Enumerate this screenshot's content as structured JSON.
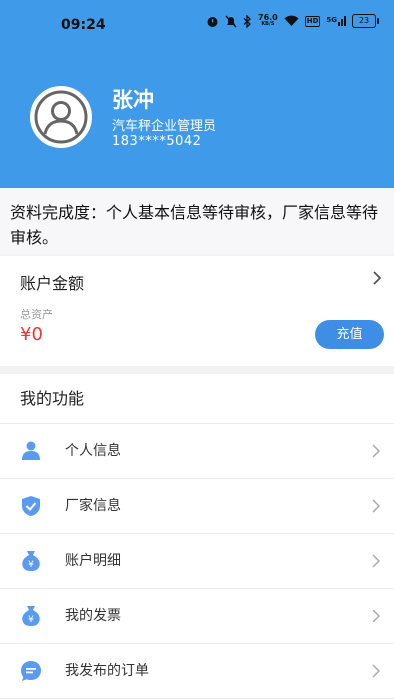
{
  "status_bar": {
    "time": "09:24",
    "speed": "76.0",
    "speed_unit": "KB/S",
    "hd": "HD",
    "network": "5G",
    "battery": "23"
  },
  "profile": {
    "name": "张冲",
    "role": "汽车秤企业管理员",
    "phone": "183****5042"
  },
  "notice": "资料完成度：个人基本信息等待审核，厂家信息等待审核。",
  "account": {
    "title": "账户金额",
    "subtitle": "总资产",
    "amount": "¥0",
    "recharge_label": "充值"
  },
  "features": {
    "title": "我的功能",
    "items": [
      {
        "label": "个人信息",
        "icon": "person-icon"
      },
      {
        "label": "厂家信息",
        "icon": "shield-check-icon"
      },
      {
        "label": "账户明细",
        "icon": "money-bag-icon"
      },
      {
        "label": "我的发票",
        "icon": "money-bag-icon"
      },
      {
        "label": "我发布的订单",
        "icon": "chat-bubble-icon"
      }
    ]
  },
  "colors": {
    "header": "#3f9be9",
    "accent": "#3f8ee6",
    "amount": "#e53935",
    "icon": "#5b9bef"
  }
}
